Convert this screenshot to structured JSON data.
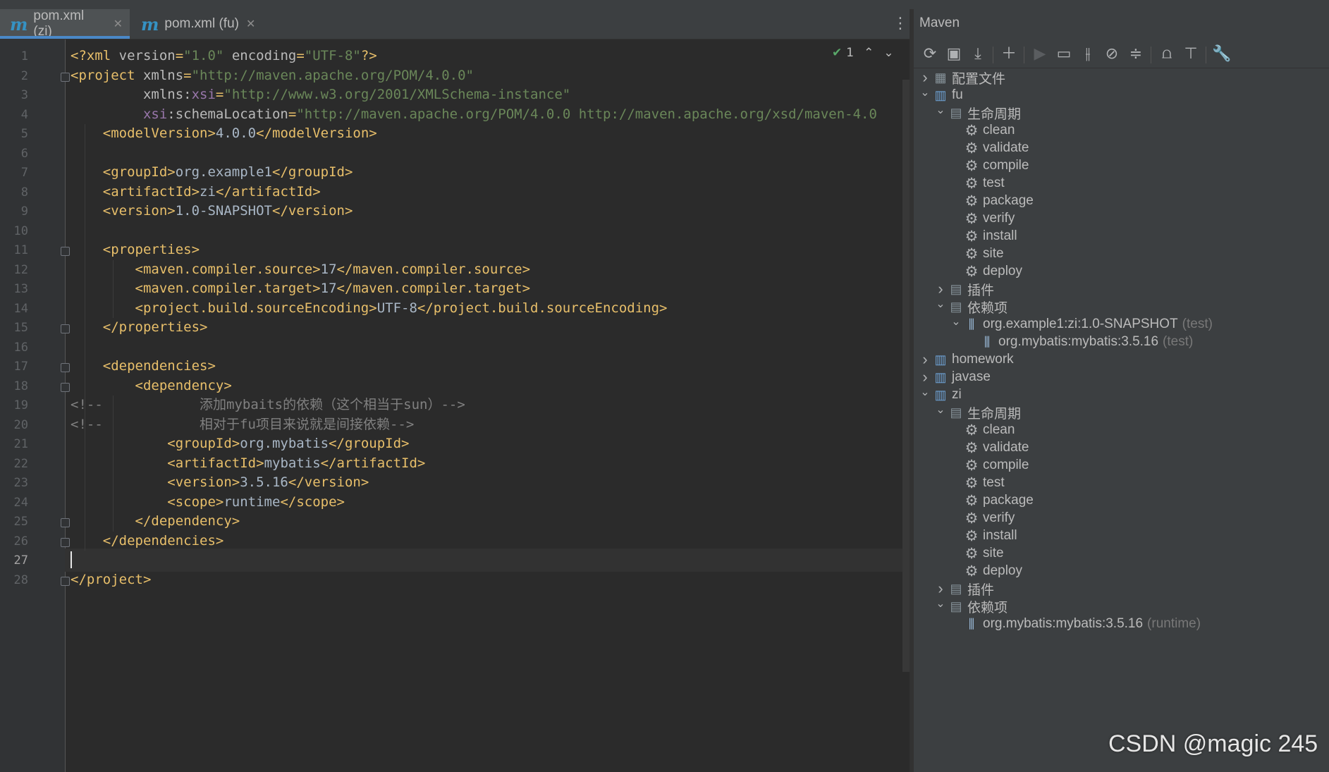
{
  "tabs": [
    {
      "label": "pom.xml (zi)",
      "active": true
    },
    {
      "label": "pom.xml (fu)",
      "active": false
    }
  ],
  "tab_icon": "m",
  "inspection": {
    "count": "1"
  },
  "editor": {
    "current_line": 27,
    "lines": [
      {
        "n": "1",
        "parts": [
          [
            "tag",
            "<?xml "
          ],
          [
            "attr",
            "version"
          ],
          [
            "tag",
            "="
          ],
          [
            "str",
            "\"1.0\""
          ],
          [
            "attr",
            " encoding"
          ],
          [
            "tag",
            "="
          ],
          [
            "str",
            "\"UTF-8\""
          ],
          [
            "tag",
            "?>"
          ]
        ]
      },
      {
        "n": "2",
        "parts": [
          [
            "tag",
            "<project "
          ],
          [
            "attr",
            "xmlns"
          ],
          [
            "tag",
            "="
          ],
          [
            "str",
            "\"http://maven.apache.org/POM/4.0.0\""
          ]
        ]
      },
      {
        "n": "3",
        "parts": [
          [
            "txt",
            "         "
          ],
          [
            "attr",
            "xmlns:"
          ],
          [
            "nsp",
            "xsi"
          ],
          [
            "tag",
            "="
          ],
          [
            "str",
            "\"http://www.w3.org/2001/XMLSchema-instance\""
          ]
        ]
      },
      {
        "n": "4",
        "parts": [
          [
            "txt",
            "         "
          ],
          [
            "nsp",
            "xsi"
          ],
          [
            "attr",
            ":schemaLocation"
          ],
          [
            "tag",
            "="
          ],
          [
            "str",
            "\"http://maven.apache.org/POM/4.0.0 http://maven.apache.org/xsd/maven-4.0"
          ]
        ]
      },
      {
        "n": "5",
        "parts": [
          [
            "txt",
            "    "
          ],
          [
            "tag",
            "<modelVersion>"
          ],
          [
            "txt",
            "4.0.0"
          ],
          [
            "tag",
            "</modelVersion>"
          ]
        ]
      },
      {
        "n": "6",
        "parts": []
      },
      {
        "n": "7",
        "parts": [
          [
            "txt",
            "    "
          ],
          [
            "tag",
            "<groupId>"
          ],
          [
            "txt",
            "org.example1"
          ],
          [
            "tag",
            "</groupId>"
          ]
        ]
      },
      {
        "n": "8",
        "parts": [
          [
            "txt",
            "    "
          ],
          [
            "tag",
            "<artifactId>"
          ],
          [
            "txt",
            "zi"
          ],
          [
            "tag",
            "</artifactId>"
          ]
        ]
      },
      {
        "n": "9",
        "parts": [
          [
            "txt",
            "    "
          ],
          [
            "tag",
            "<version>"
          ],
          [
            "txt",
            "1.0-SNAPSHOT"
          ],
          [
            "tag",
            "</version>"
          ]
        ]
      },
      {
        "n": "10",
        "parts": []
      },
      {
        "n": "11",
        "parts": [
          [
            "txt",
            "    "
          ],
          [
            "tag",
            "<properties>"
          ]
        ]
      },
      {
        "n": "12",
        "parts": [
          [
            "txt",
            "        "
          ],
          [
            "tag",
            "<maven.compiler.source>"
          ],
          [
            "txt",
            "17"
          ],
          [
            "tag",
            "</maven.compiler.source>"
          ]
        ]
      },
      {
        "n": "13",
        "parts": [
          [
            "txt",
            "        "
          ],
          [
            "tag",
            "<maven.compiler.target>"
          ],
          [
            "txt",
            "17"
          ],
          [
            "tag",
            "</maven.compiler.target>"
          ]
        ]
      },
      {
        "n": "14",
        "parts": [
          [
            "txt",
            "        "
          ],
          [
            "tag",
            "<project.build.sourceEncoding>"
          ],
          [
            "txt",
            "UTF-8"
          ],
          [
            "tag",
            "</project.build.sourceEncoding>"
          ]
        ]
      },
      {
        "n": "15",
        "parts": [
          [
            "txt",
            "    "
          ],
          [
            "tag",
            "</properties>"
          ]
        ]
      },
      {
        "n": "16",
        "parts": []
      },
      {
        "n": "17",
        "parts": [
          [
            "txt",
            "    "
          ],
          [
            "tag",
            "<dependencies>"
          ]
        ]
      },
      {
        "n": "18",
        "parts": [
          [
            "txt",
            "        "
          ],
          [
            "tag",
            "<dependency>"
          ]
        ]
      },
      {
        "n": "19",
        "parts": [
          [
            "cmtm",
            "<!--            "
          ],
          [
            "cmt",
            "添加"
          ],
          [
            "cmtm",
            "mybaits"
          ],
          [
            "cmt",
            "的依赖（这个相当于"
          ],
          [
            "cmtm",
            "sun"
          ],
          [
            "cmt",
            "）"
          ],
          [
            "cmtm",
            "-->"
          ]
        ]
      },
      {
        "n": "20",
        "parts": [
          [
            "cmtm",
            "<!--            "
          ],
          [
            "cmt",
            "相对于"
          ],
          [
            "cmtm",
            "fu"
          ],
          [
            "cmt",
            "项目来说就是间接依赖"
          ],
          [
            "cmtm",
            "-->"
          ]
        ]
      },
      {
        "n": "21",
        "parts": [
          [
            "txt",
            "            "
          ],
          [
            "tag",
            "<groupId>"
          ],
          [
            "txt",
            "org.mybatis"
          ],
          [
            "tag",
            "</groupId>"
          ]
        ]
      },
      {
        "n": "22",
        "parts": [
          [
            "txt",
            "            "
          ],
          [
            "tag",
            "<artifactId>"
          ],
          [
            "txt",
            "mybatis"
          ],
          [
            "tag",
            "</artifactId>"
          ]
        ]
      },
      {
        "n": "23",
        "parts": [
          [
            "txt",
            "            "
          ],
          [
            "tag",
            "<version>"
          ],
          [
            "txt",
            "3.5.16"
          ],
          [
            "tag",
            "</version>"
          ]
        ]
      },
      {
        "n": "24",
        "parts": [
          [
            "txt",
            "            "
          ],
          [
            "tag",
            "<scope>"
          ],
          [
            "txt",
            "runtime"
          ],
          [
            "tag",
            "</scope>"
          ]
        ]
      },
      {
        "n": "25",
        "parts": [
          [
            "txt",
            "        "
          ],
          [
            "tag",
            "</dependency>"
          ]
        ]
      },
      {
        "n": "26",
        "parts": [
          [
            "txt",
            "    "
          ],
          [
            "tag",
            "</dependencies>"
          ]
        ]
      },
      {
        "n": "27",
        "parts": []
      },
      {
        "n": "28",
        "parts": [
          [
            "tag",
            "</project>"
          ]
        ]
      }
    ]
  },
  "maven": {
    "title": "Maven",
    "toolbar": [
      "reload-icon",
      "add-maven-project-icon",
      "download-icon",
      "plus-icon",
      "run-icon",
      "execute-goal-icon",
      "toggle-offline-icon",
      "skip-tests-icon",
      "collapse-icon",
      "analyze-dependencies-icon",
      "show-dependencies-icon",
      "settings-wrench-icon"
    ],
    "tree": [
      {
        "level": 0,
        "arrow": "right",
        "icon": "profiles",
        "label": "配置文件"
      },
      {
        "level": 0,
        "arrow": "down",
        "icon": "module",
        "label": "fu"
      },
      {
        "level": 1,
        "arrow": "down",
        "icon": "lifecycle",
        "label": "生命周期"
      },
      {
        "level": 2,
        "arrow": "",
        "icon": "gear",
        "label": "clean"
      },
      {
        "level": 2,
        "arrow": "",
        "icon": "gear",
        "label": "validate"
      },
      {
        "level": 2,
        "arrow": "",
        "icon": "gear",
        "label": "compile"
      },
      {
        "level": 2,
        "arrow": "",
        "icon": "gear",
        "label": "test"
      },
      {
        "level": 2,
        "arrow": "",
        "icon": "gear",
        "label": "package"
      },
      {
        "level": 2,
        "arrow": "",
        "icon": "gear",
        "label": "verify"
      },
      {
        "level": 2,
        "arrow": "",
        "icon": "gear",
        "label": "install"
      },
      {
        "level": 2,
        "arrow": "",
        "icon": "gear",
        "label": "site"
      },
      {
        "level": 2,
        "arrow": "",
        "icon": "gear",
        "label": "deploy"
      },
      {
        "level": 1,
        "arrow": "right",
        "icon": "plugins",
        "label": "插件"
      },
      {
        "level": 1,
        "arrow": "down",
        "icon": "deps",
        "label": "依赖项"
      },
      {
        "level": 2,
        "arrow": "down",
        "icon": "lib",
        "label": "org.example1:zi:1.0-SNAPSHOT",
        "suffix": "(test)"
      },
      {
        "level": 3,
        "arrow": "",
        "icon": "lib",
        "label": "org.mybatis:mybatis:3.5.16",
        "suffix": "(test)"
      },
      {
        "level": 0,
        "arrow": "right",
        "icon": "module",
        "label": "homework"
      },
      {
        "level": 0,
        "arrow": "right",
        "icon": "module",
        "label": "javase"
      },
      {
        "level": 0,
        "arrow": "down",
        "icon": "module",
        "label": "zi"
      },
      {
        "level": 1,
        "arrow": "down",
        "icon": "lifecycle",
        "label": "生命周期"
      },
      {
        "level": 2,
        "arrow": "",
        "icon": "gear",
        "label": "clean"
      },
      {
        "level": 2,
        "arrow": "",
        "icon": "gear",
        "label": "validate"
      },
      {
        "level": 2,
        "arrow": "",
        "icon": "gear",
        "label": "compile"
      },
      {
        "level": 2,
        "arrow": "",
        "icon": "gear",
        "label": "test"
      },
      {
        "level": 2,
        "arrow": "",
        "icon": "gear",
        "label": "package"
      },
      {
        "level": 2,
        "arrow": "",
        "icon": "gear",
        "label": "verify"
      },
      {
        "level": 2,
        "arrow": "",
        "icon": "gear",
        "label": "install"
      },
      {
        "level": 2,
        "arrow": "",
        "icon": "gear",
        "label": "site"
      },
      {
        "level": 2,
        "arrow": "",
        "icon": "gear",
        "label": "deploy"
      },
      {
        "level": 1,
        "arrow": "right",
        "icon": "plugins",
        "label": "插件"
      },
      {
        "level": 1,
        "arrow": "down",
        "icon": "deps",
        "label": "依赖项"
      },
      {
        "level": 2,
        "arrow": "",
        "icon": "lib",
        "label": "org.mybatis:mybatis:3.5.16",
        "suffix": "(runtime)"
      }
    ]
  },
  "watermark": "CSDN @magic 245"
}
